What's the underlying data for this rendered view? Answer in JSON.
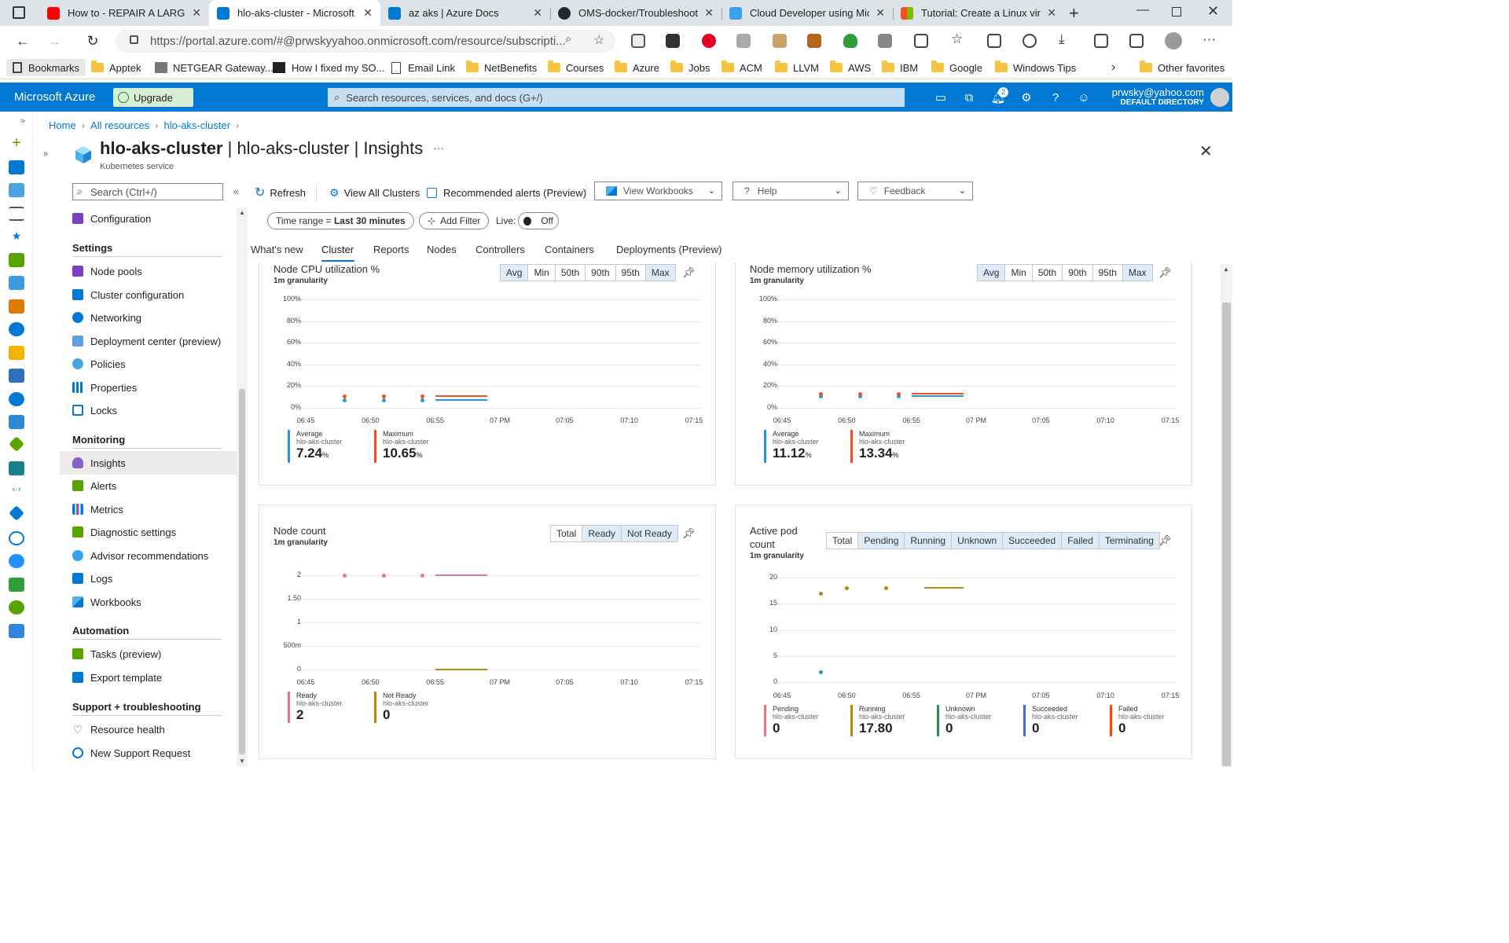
{
  "browser": {
    "tabs": [
      {
        "title": "How to - REPAIR A LARGE H",
        "favcolor": "#ff0000"
      },
      {
        "title": "hlo-aks-cluster - Microsoft A",
        "favcolor": "#0078d4"
      },
      {
        "title": "az aks | Azure Docs",
        "favcolor": "#0078d4"
      },
      {
        "title": "OMS-docker/Troubleshoot",
        "favcolor": "#24292e"
      },
      {
        "title": "Cloud Developer using Mic",
        "favcolor": "#3aa0f0"
      },
      {
        "title": "Tutorial: Create a Linux virtu",
        "favcolor": "#f25022"
      }
    ],
    "url": "https://portal.azure.com/#@prwskyyahoo.onmicrosoft.com/resource/subscripti...",
    "bookmarks": [
      "Bookmarks",
      "Apptek",
      "NETGEAR Gateway...",
      "How I fixed my SO...",
      "Email Link",
      "NetBenefits",
      "Courses",
      "Azure",
      "Jobs",
      "ACM",
      "LLVM",
      "AWS",
      "IBM",
      "Google",
      "Windows Tips"
    ],
    "other_favorites": "Other favorites"
  },
  "azure": {
    "brand": "Microsoft Azure",
    "upgrade": "Upgrade",
    "search_placeholder": "Search resources, services, and docs (G+/)",
    "notif_count": "2",
    "user_email": "prwsky@yahoo.com",
    "user_dir": "DEFAULT DIRECTORY"
  },
  "breadcrumb": [
    "Home",
    "All resources",
    "hlo-aks-cluster"
  ],
  "page": {
    "title_bold": "hlo-aks-cluster",
    "title_rest": " | hlo-aks-cluster | Insights",
    "subtitle": "Kubernetes service",
    "more": "···"
  },
  "menu": {
    "search_placeholder": "Search (Ctrl+/)",
    "items": [
      {
        "label": "Configuration",
        "color": "#7b3fbf"
      },
      {
        "label": "Node pools",
        "color": "#7b3fbf"
      },
      {
        "label": "Cluster configuration",
        "color": "#0078d4"
      },
      {
        "label": "Networking",
        "color": "#0078d4"
      },
      {
        "label": "Deployment center (preview)",
        "color": "#0078d4"
      },
      {
        "label": "Policies",
        "color": "#0078d4"
      },
      {
        "label": "Properties",
        "color": "#0078d4"
      },
      {
        "label": "Locks",
        "color": "#0078d4"
      },
      {
        "label": "Insights",
        "color": "#8661c5"
      },
      {
        "label": "Alerts",
        "color": "#57a300"
      },
      {
        "label": "Metrics",
        "color": "#0078d4"
      },
      {
        "label": "Diagnostic settings",
        "color": "#57a300"
      },
      {
        "label": "Advisor recommendations",
        "color": "#0078d4"
      },
      {
        "label": "Logs",
        "color": "#0078d4"
      },
      {
        "label": "Workbooks",
        "color": "#0078d4"
      },
      {
        "label": "Tasks (preview)",
        "color": "#57a300"
      },
      {
        "label": "Export template",
        "color": "#0078d4"
      },
      {
        "label": "Resource health",
        "color": "#555555"
      },
      {
        "label": "New Support Request",
        "color": "#0078d4"
      }
    ],
    "headers": [
      "Settings",
      "Monitoring",
      "Automation",
      "Support + troubleshooting"
    ]
  },
  "toolbar": {
    "refresh": "Refresh",
    "view_all": "View All Clusters",
    "alerts": "Recommended alerts (Preview)",
    "workbooks": "View Workbooks",
    "help": "Help",
    "feedback": "Feedback"
  },
  "filters": {
    "time_prefix": "Time range = ",
    "time_value": "Last 30 minutes",
    "add_filter": "Add Filter",
    "live_label": "Live:",
    "live_value": "Off"
  },
  "subtabs": [
    "What's new",
    "Cluster",
    "Reports",
    "Nodes",
    "Controllers",
    "Containers",
    "Deployments (Preview)"
  ],
  "cards": {
    "cpu": {
      "title": "Node CPU utilization %",
      "gran": "1m granularity",
      "agg": [
        "Avg",
        "Min",
        "50th",
        "90th",
        "95th",
        "Max"
      ],
      "avg_label": "Average",
      "avg_sub": "hlo-aks-cluster",
      "avg_val": "7.24",
      "avg_unit": "%",
      "max_label": "Maximum",
      "max_sub": "hlo-aks-cluster",
      "max_val": "10.65",
      "max_unit": "%"
    },
    "mem": {
      "title": "Node memory utilization %",
      "gran": "1m granularity",
      "agg": [
        "Avg",
        "Min",
        "50th",
        "90th",
        "95th",
        "Max"
      ],
      "avg_label": "Average",
      "avg_sub": "hlo-aks-cluster",
      "avg_val": "11.12",
      "avg_unit": "%",
      "max_label": "Maximum",
      "max_sub": "hlo-aks-cluster",
      "max_val": "13.34",
      "max_unit": "%"
    },
    "node": {
      "title": "Node count",
      "gran": "1m granularity",
      "agg": [
        "Total",
        "Ready",
        "Not Ready"
      ],
      "l1_label": "Ready",
      "l1_sub": "hlo-aks-cluster",
      "l1_val": "2",
      "l2_label": "Not Ready",
      "l2_sub": "hlo-aks-cluster",
      "l2_val": "0"
    },
    "pod": {
      "title1": "Active pod",
      "title2": "count",
      "gran": "1m granularity",
      "agg": [
        "Total",
        "Pending",
        "Running",
        "Unknown",
        "Succeeded",
        "Failed",
        "Terminating"
      ],
      "legend": [
        {
          "label": "Pending",
          "sub": "hlo-aks-cluster",
          "val": "0",
          "color": "#e8748a"
        },
        {
          "label": "Running",
          "sub": "hlo-aks-cluster",
          "val": "17.80",
          "color": "#b8860b"
        },
        {
          "label": "Unknown",
          "sub": "hlo-aks-cluster",
          "val": "0",
          "color": "#2e8b57"
        },
        {
          "label": "Succeeded",
          "sub": "hlo-aks-cluster",
          "val": "0",
          "color": "#4169e1"
        },
        {
          "label": "Failed",
          "sub": "hlo-aks-cluster",
          "val": "0",
          "color": "#ff4500"
        }
      ]
    }
  },
  "chart_data": [
    {
      "type": "line",
      "title": "Node CPU utilization %",
      "x": [
        "06:45",
        "06:50",
        "06:55",
        "07 PM",
        "07:05",
        "07:10",
        "07:15"
      ],
      "yticks": [
        "100%",
        "80%",
        "60%",
        "40%",
        "20%",
        "0%"
      ],
      "ylim": [
        0,
        100
      ],
      "series": [
        {
          "name": "Average",
          "color": "#2896d8",
          "values": [
            {
              "t": "06:48",
              "v": 7.2
            },
            {
              "t": "06:51",
              "v": 7.2
            },
            {
              "t": "06:54",
              "v": 7.2
            },
            {
              "t": "06:55",
              "v": 7.2
            },
            {
              "t": "06:59",
              "v": 7.2
            }
          ]
        },
        {
          "name": "Maximum",
          "color": "#f25022",
          "values": [
            {
              "t": "06:48",
              "v": 10.6
            },
            {
              "t": "06:51",
              "v": 10.6
            },
            {
              "t": "06:54",
              "v": 10.6
            },
            {
              "t": "06:55",
              "v": 10.6
            },
            {
              "t": "06:59",
              "v": 10.6
            }
          ]
        }
      ]
    },
    {
      "type": "line",
      "title": "Node memory utilization %",
      "x": [
        "06:45",
        "06:50",
        "06:55",
        "07 PM",
        "07:05",
        "07:10",
        "07:15"
      ],
      "yticks": [
        "100%",
        "80%",
        "60%",
        "40%",
        "20%",
        "0%"
      ],
      "ylim": [
        0,
        100
      ],
      "series": [
        {
          "name": "Average",
          "color": "#2896d8",
          "values": [
            {
              "t": "06:48",
              "v": 11.1
            },
            {
              "t": "06:51",
              "v": 11.1
            },
            {
              "t": "06:54",
              "v": 11.1
            },
            {
              "t": "06:55",
              "v": 11.1
            },
            {
              "t": "06:59",
              "v": 11.1
            }
          ]
        },
        {
          "name": "Maximum",
          "color": "#f25022",
          "values": [
            {
              "t": "06:48",
              "v": 13.3
            },
            {
              "t": "06:51",
              "v": 13.3
            },
            {
              "t": "06:54",
              "v": 13.3
            },
            {
              "t": "06:55",
              "v": 13.3
            },
            {
              "t": "06:59",
              "v": 13.3
            }
          ]
        }
      ]
    },
    {
      "type": "line",
      "title": "Node count",
      "x": [
        "06:45",
        "06:50",
        "06:55",
        "07 PM",
        "07:05",
        "07:10",
        "07:15"
      ],
      "yticks": [
        "2",
        "1.50",
        "1",
        "500m",
        "0"
      ],
      "ylim": [
        0,
        2
      ],
      "series": [
        {
          "name": "Ready",
          "color": "#e8748a",
          "values": [
            {
              "t": "06:48",
              "v": 2
            },
            {
              "t": "06:51",
              "v": 2
            },
            {
              "t": "06:54",
              "v": 2
            },
            {
              "t": "06:55",
              "v": 2
            },
            {
              "t": "06:59",
              "v": 2
            }
          ]
        },
        {
          "name": "Not Ready",
          "color": "#b8860b",
          "values": [
            {
              "t": "06:55",
              "v": 0
            },
            {
              "t": "06:59",
              "v": 0
            }
          ]
        }
      ]
    },
    {
      "type": "line",
      "title": "Active pod count",
      "x": [
        "06:45",
        "06:50",
        "06:55",
        "07 PM",
        "07:05",
        "07:10",
        "07:15"
      ],
      "yticks": [
        "20",
        "15",
        "10",
        "5",
        "0"
      ],
      "ylim": [
        0,
        20
      ],
      "series": [
        {
          "name": "Running",
          "color": "#b8860b",
          "values": [
            {
              "t": "06:48",
              "v": 17
            },
            {
              "t": "06:50",
              "v": 18
            },
            {
              "t": "06:53",
              "v": 18
            },
            {
              "t": "06:56",
              "v": 18
            },
            {
              "t": "06:59",
              "v": 18
            }
          ]
        },
        {
          "name": "Pending",
          "color": "#2896d8",
          "values": [
            {
              "t": "06:48",
              "v": 2
            }
          ]
        }
      ]
    }
  ]
}
